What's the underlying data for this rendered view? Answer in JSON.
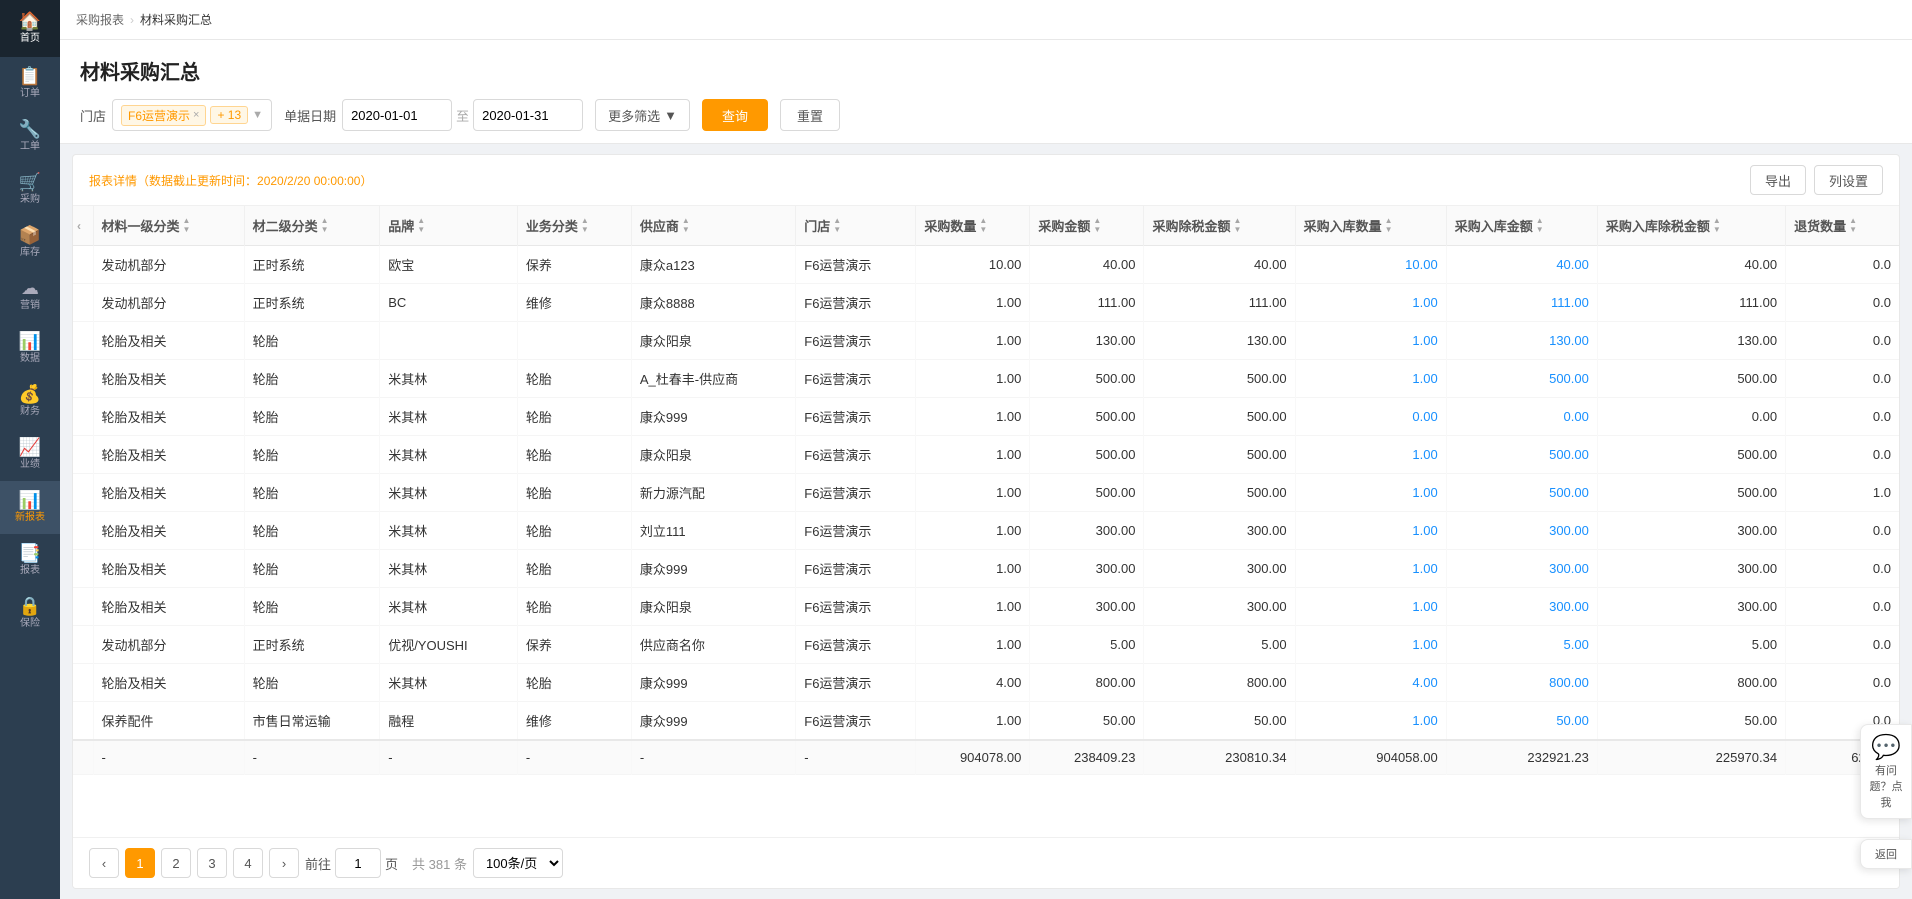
{
  "app": {
    "title": "材料采购汇总"
  },
  "breadcrumb": {
    "parent": "采购报表",
    "current": "材料采购汇总"
  },
  "sidebar": {
    "items": [
      {
        "id": "home",
        "label": "首页",
        "icon": "🏠"
      },
      {
        "id": "order",
        "label": "订单",
        "icon": "📋"
      },
      {
        "id": "work",
        "label": "工单",
        "icon": "🔧"
      },
      {
        "id": "purchase",
        "label": "采购",
        "icon": "🛒"
      },
      {
        "id": "stock",
        "label": "库存",
        "icon": "📦"
      },
      {
        "id": "marketing",
        "label": "营销",
        "icon": "☁"
      },
      {
        "id": "data",
        "label": "数据",
        "icon": "📊"
      },
      {
        "id": "finance",
        "label": "财务",
        "icon": "💰"
      },
      {
        "id": "performance",
        "label": "业绩",
        "icon": "📈"
      },
      {
        "id": "newreport",
        "label": "新报表",
        "icon": "📊",
        "active": true
      },
      {
        "id": "report",
        "label": "报表",
        "icon": "📑"
      },
      {
        "id": "insurance",
        "label": "保险",
        "icon": "🔒"
      }
    ]
  },
  "filters": {
    "store_label": "门店",
    "store_tag": "F6运营演示",
    "store_count": "+ 13",
    "date_label": "单据日期",
    "date_from": "2020-01-01",
    "date_to": "2020-01-31",
    "more_label": "更多筛选",
    "query_label": "查询",
    "reset_label": "重置"
  },
  "table": {
    "info_prefix": "报表详情（数据截止更新时间：",
    "info_time": "2020/2/20 00:00:00",
    "info_suffix": "）",
    "export_label": "导出",
    "col_set_label": "列设置",
    "columns": [
      {
        "key": "cat1",
        "label": "材料一级分类"
      },
      {
        "key": "cat2",
        "label": "材二级分类"
      },
      {
        "key": "brand",
        "label": "品牌"
      },
      {
        "key": "biz",
        "label": "业务分类"
      },
      {
        "key": "supplier",
        "label": "供应商"
      },
      {
        "key": "store",
        "label": "门店"
      },
      {
        "key": "qty",
        "label": "采购数量"
      },
      {
        "key": "amount",
        "label": "采购金额"
      },
      {
        "key": "tax_amount",
        "label": "采购除税金额"
      },
      {
        "key": "in_qty",
        "label": "采购入库数量"
      },
      {
        "key": "in_amount",
        "label": "采购入库金额"
      },
      {
        "key": "in_tax_amount",
        "label": "采购入库除税金额"
      },
      {
        "key": "return_qty",
        "label": "退货数量"
      }
    ],
    "rows": [
      {
        "cat1": "发动机部分",
        "cat2": "正时系统",
        "brand": "欧宝",
        "biz": "保养",
        "supplier": "康众a123",
        "store": "F6运营演示",
        "qty": "10.00",
        "amount": "40.00",
        "tax_amount": "40.00",
        "in_qty": "10.00",
        "in_amount": "40.00",
        "in_tax_amount": "40.00",
        "return_qty": "0.0"
      },
      {
        "cat1": "发动机部分",
        "cat2": "正时系统",
        "brand": "BC",
        "biz": "维修",
        "supplier": "康众8888",
        "store": "F6运营演示",
        "qty": "1.00",
        "amount": "111.00",
        "tax_amount": "111.00",
        "in_qty": "1.00",
        "in_amount": "111.00",
        "in_tax_amount": "111.00",
        "return_qty": "0.0"
      },
      {
        "cat1": "轮胎及相关",
        "cat2": "轮胎",
        "brand": "",
        "biz": "",
        "supplier": "康众阳泉",
        "store": "F6运营演示",
        "qty": "1.00",
        "amount": "130.00",
        "tax_amount": "130.00",
        "in_qty": "1.00",
        "in_amount": "130.00",
        "in_tax_amount": "130.00",
        "return_qty": "0.0"
      },
      {
        "cat1": "轮胎及相关",
        "cat2": "轮胎",
        "brand": "米其林",
        "biz": "轮胎",
        "supplier": "A_杜春丰-供应商",
        "store": "F6运营演示",
        "qty": "1.00",
        "amount": "500.00",
        "tax_amount": "500.00",
        "in_qty": "1.00",
        "in_amount": "500.00",
        "in_tax_amount": "500.00",
        "return_qty": "0.0"
      },
      {
        "cat1": "轮胎及相关",
        "cat2": "轮胎",
        "brand": "米其林",
        "biz": "轮胎",
        "supplier": "康众999",
        "store": "F6运营演示",
        "qty": "1.00",
        "amount": "500.00",
        "tax_amount": "500.00",
        "in_qty": "0.00",
        "in_amount": "0.00",
        "in_tax_amount": "0.00",
        "return_qty": "0.0"
      },
      {
        "cat1": "轮胎及相关",
        "cat2": "轮胎",
        "brand": "米其林",
        "biz": "轮胎",
        "supplier": "康众阳泉",
        "store": "F6运营演示",
        "qty": "1.00",
        "amount": "500.00",
        "tax_amount": "500.00",
        "in_qty": "1.00",
        "in_amount": "500.00",
        "in_tax_amount": "500.00",
        "return_qty": "0.0"
      },
      {
        "cat1": "轮胎及相关",
        "cat2": "轮胎",
        "brand": "米其林",
        "biz": "轮胎",
        "supplier": "新力源汽配",
        "store": "F6运营演示",
        "qty": "1.00",
        "amount": "500.00",
        "tax_amount": "500.00",
        "in_qty": "1.00",
        "in_amount": "500.00",
        "in_tax_amount": "500.00",
        "return_qty": "1.0"
      },
      {
        "cat1": "轮胎及相关",
        "cat2": "轮胎",
        "brand": "米其林",
        "biz": "轮胎",
        "supplier": "刘立111",
        "store": "F6运营演示",
        "qty": "1.00",
        "amount": "300.00",
        "tax_amount": "300.00",
        "in_qty": "1.00",
        "in_amount": "300.00",
        "in_tax_amount": "300.00",
        "return_qty": "0.0"
      },
      {
        "cat1": "轮胎及相关",
        "cat2": "轮胎",
        "brand": "米其林",
        "biz": "轮胎",
        "supplier": "康众999",
        "store": "F6运营演示",
        "qty": "1.00",
        "amount": "300.00",
        "tax_amount": "300.00",
        "in_qty": "1.00",
        "in_amount": "300.00",
        "in_tax_amount": "300.00",
        "return_qty": "0.0"
      },
      {
        "cat1": "轮胎及相关",
        "cat2": "轮胎",
        "brand": "米其林",
        "biz": "轮胎",
        "supplier": "康众阳泉",
        "store": "F6运营演示",
        "qty": "1.00",
        "amount": "300.00",
        "tax_amount": "300.00",
        "in_qty": "1.00",
        "in_amount": "300.00",
        "in_tax_amount": "300.00",
        "return_qty": "0.0"
      },
      {
        "cat1": "发动机部分",
        "cat2": "正时系统",
        "brand": "优视/YOUSHI",
        "biz": "保养",
        "supplier": "供应商名你",
        "store": "F6运营演示",
        "qty": "1.00",
        "amount": "5.00",
        "tax_amount": "5.00",
        "in_qty": "1.00",
        "in_amount": "5.00",
        "in_tax_amount": "5.00",
        "return_qty": "0.0"
      },
      {
        "cat1": "轮胎及相关",
        "cat2": "轮胎",
        "brand": "米其林",
        "biz": "轮胎",
        "supplier": "康众999",
        "store": "F6运营演示",
        "qty": "4.00",
        "amount": "800.00",
        "tax_amount": "800.00",
        "in_qty": "4.00",
        "in_amount": "800.00",
        "in_tax_amount": "800.00",
        "return_qty": "0.0"
      },
      {
        "cat1": "保养配件",
        "cat2": "市售日常运输",
        "brand": "融程",
        "biz": "维修",
        "supplier": "康众999",
        "store": "F6运营演示",
        "qty": "1.00",
        "amount": "50.00",
        "tax_amount": "50.00",
        "in_qty": "1.00",
        "in_amount": "50.00",
        "in_tax_amount": "50.00",
        "return_qty": "0.0"
      }
    ],
    "summary": {
      "cat1": "-",
      "cat2": "-",
      "brand": "-",
      "biz": "-",
      "supplier": "-",
      "store": "-",
      "qty": "904078.00",
      "amount": "238409.23",
      "tax_amount": "230810.34",
      "in_qty": "904058.00",
      "in_amount": "232921.23",
      "in_tax_amount": "225970.34",
      "return_qty": "621.00"
    }
  },
  "pagination": {
    "current": 1,
    "pages": [
      "1",
      "2",
      "3",
      "4"
    ],
    "goto_label": "前往",
    "page_label": "页",
    "total_label": "共 381 条",
    "size_label": "100条/页"
  },
  "help": {
    "label": "有问题？点我",
    "icon": "💬"
  },
  "back_label": "返回"
}
